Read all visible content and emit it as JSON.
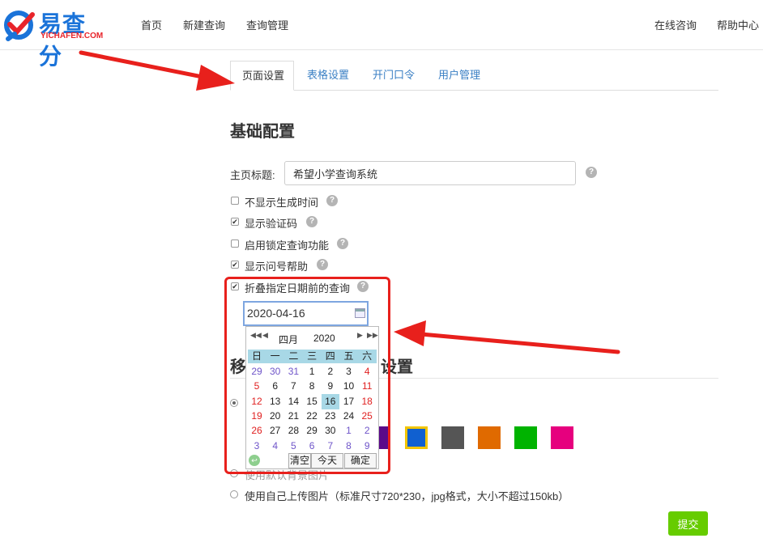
{
  "brand": {
    "name": "易查分",
    "domain": "YICHAFEN.COM",
    "colors": {
      "blue": "#1a73d9",
      "red": "#e8242a"
    }
  },
  "nav": {
    "home": "首页",
    "new_query": "新建查询",
    "query_manage": "查询管理",
    "online_consult": "在线咨询",
    "help_center": "帮助中心"
  },
  "tabs": [
    "页面设置",
    "表格设置",
    "开门口令",
    "用户管理"
  ],
  "active_tab": "页面设置",
  "section1": {
    "title": "基础配置"
  },
  "home_title": {
    "label": "主页标题:",
    "value": "希望小学查询系统"
  },
  "options": [
    {
      "label": "不显示生成时间",
      "checked": false
    },
    {
      "label": "显示验证码",
      "checked": true
    },
    {
      "label": "启用锁定查询功能",
      "checked": false
    },
    {
      "label": "显示问号帮助",
      "checked": true
    },
    {
      "label": "折叠指定日期前的查询",
      "checked": true
    }
  ],
  "help_icon": "question-circle-icon",
  "date_value": "2020-04-16",
  "calendar": {
    "month": "四月",
    "year": "2020",
    "weekdays": [
      "日",
      "一",
      "二",
      "三",
      "四",
      "五",
      "六"
    ],
    "weeks": [
      [
        "29",
        "30",
        "31",
        "1",
        "2",
        "3",
        "4"
      ],
      [
        "5",
        "6",
        "7",
        "8",
        "9",
        "10",
        "11"
      ],
      [
        "12",
        "13",
        "14",
        "15",
        "16",
        "17",
        "18"
      ],
      [
        "19",
        "20",
        "21",
        "22",
        "23",
        "24",
        "25"
      ],
      [
        "26",
        "27",
        "28",
        "29",
        "30",
        "1",
        "2"
      ],
      [
        "3",
        "4",
        "5",
        "6",
        "7",
        "8",
        "9"
      ]
    ],
    "selected_day": "16",
    "buttons": {
      "clear": "清空",
      "today": "今天",
      "confirm": "确定"
    }
  },
  "section2": {
    "title_left": "移",
    "title_right": "设置"
  },
  "bg_colors": [
    "#5a0a8a",
    "#1060d0",
    "#555555",
    "#e06a00",
    "#00b300",
    "#e6007e"
  ],
  "selected_bg_color": "#1060d0",
  "bg_options": [
    {
      "label": "使用默认背景图片",
      "selected": false
    },
    {
      "label": "使用自己上传图片（标准尺寸720*230，jpg格式，大小不超过150kb）",
      "selected": false
    }
  ],
  "submit_label": "提交",
  "annotation_color": "#e8201c"
}
